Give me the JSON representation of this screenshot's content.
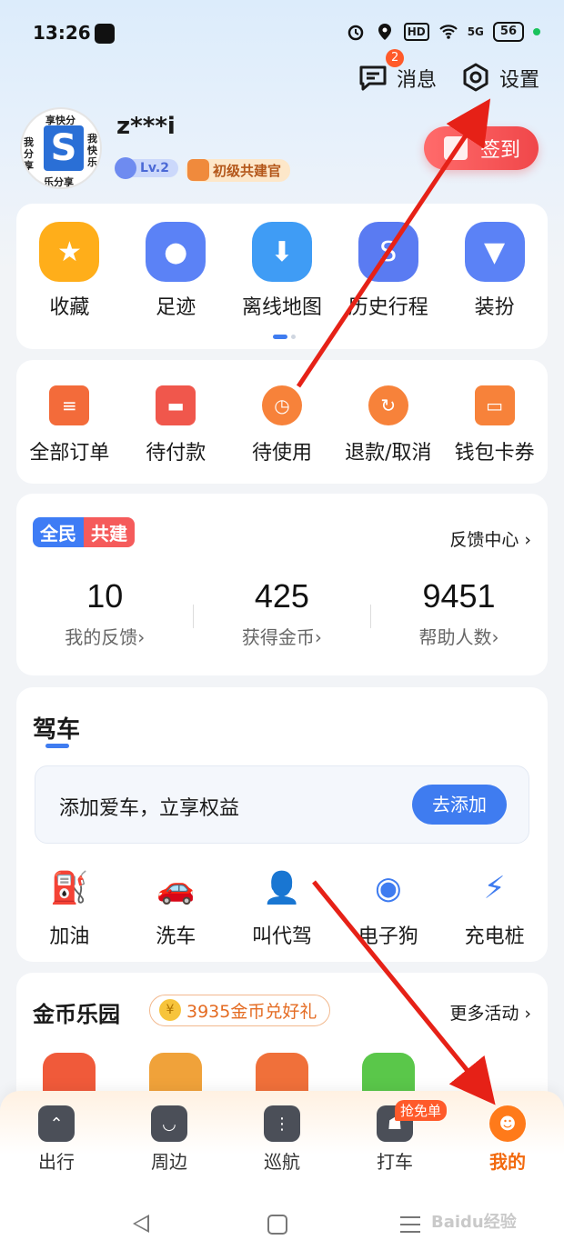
{
  "status_bar": {
    "time": "13:26",
    "hd": "HD",
    "signal": "5G",
    "battery": "56"
  },
  "header": {
    "messages_label": "消息",
    "messages_badge": "2",
    "settings_label": "设置"
  },
  "profile": {
    "avatar_text_top": "享快分",
    "avatar_text_left": "我分享",
    "avatar_text_right": "我快乐",
    "avatar_text_bottom": "乐分享",
    "avatar_letter": "S",
    "username": "z***i",
    "level": "Lv.2",
    "title_badge": "初级共建官",
    "checkin_label": "签到"
  },
  "quick_grid": [
    {
      "label": "收藏",
      "icon": "star-icon",
      "color": "#ffae1a"
    },
    {
      "label": "足迹",
      "icon": "footprint-icon",
      "color": "#5b82f6"
    },
    {
      "label": "离线地图",
      "icon": "cloud-download-icon",
      "color": "#3f9cf5"
    },
    {
      "label": "历史行程",
      "icon": "route-icon",
      "color": "#5a7bf2"
    },
    {
      "label": "装扮",
      "icon": "tshirt-icon",
      "color": "#5b82f6"
    }
  ],
  "orders": [
    {
      "label": "全部订单",
      "icon": "order-list-icon",
      "color": "#f36b3a"
    },
    {
      "label": "待付款",
      "icon": "card-icon",
      "color": "#f0574c"
    },
    {
      "label": "待使用",
      "icon": "clock-icon",
      "color": "#f7823a"
    },
    {
      "label": "退款/取消",
      "icon": "refresh-icon",
      "color": "#f7823a"
    },
    {
      "label": "钱包卡券",
      "icon": "wallet-icon",
      "color": "#f7823a"
    }
  ],
  "community": {
    "tag_a": "全民",
    "tag_b": "共建",
    "feedback_center": "反馈中心 ›",
    "stats": [
      {
        "value": "10",
        "label": "我的反馈›"
      },
      {
        "value": "425",
        "label": "获得金币›"
      },
      {
        "value": "9451",
        "label": "帮助人数›"
      }
    ]
  },
  "driving": {
    "title": "驾车",
    "add_car_text": "添加爱车，立享权益",
    "add_car_button": "去添加",
    "items": [
      {
        "label": "加油",
        "icon": "fuel-icon"
      },
      {
        "label": "洗车",
        "icon": "car-wash-icon"
      },
      {
        "label": "叫代驾",
        "icon": "driver-icon"
      },
      {
        "label": "电子狗",
        "icon": "camera-dog-icon"
      },
      {
        "label": "充电桩",
        "icon": "charging-icon"
      }
    ]
  },
  "coins": {
    "title": "金币乐园",
    "pill": "3935金币兑好礼",
    "more": "更多活动 ›",
    "item_colors": [
      "#f05a3a",
      "#f0a23a",
      "#f0703a",
      "#5ac74a",
      "#ffffff"
    ]
  },
  "bottom_nav": [
    {
      "label": "出行",
      "icon": "travel-icon",
      "active": false
    },
    {
      "label": "周边",
      "icon": "nearby-icon",
      "active": false
    },
    {
      "label": "巡航",
      "icon": "cruise-icon",
      "active": false
    },
    {
      "label": "打车",
      "icon": "taxi-icon",
      "active": false,
      "badge": "抢免单"
    },
    {
      "label": "我的",
      "icon": "me-icon",
      "active": true
    }
  ],
  "watermark": "Baidu经验",
  "colors": {
    "accent": "#3f7cf0",
    "active_orange": "#f26a0f",
    "annotation_red": "#e62117"
  }
}
